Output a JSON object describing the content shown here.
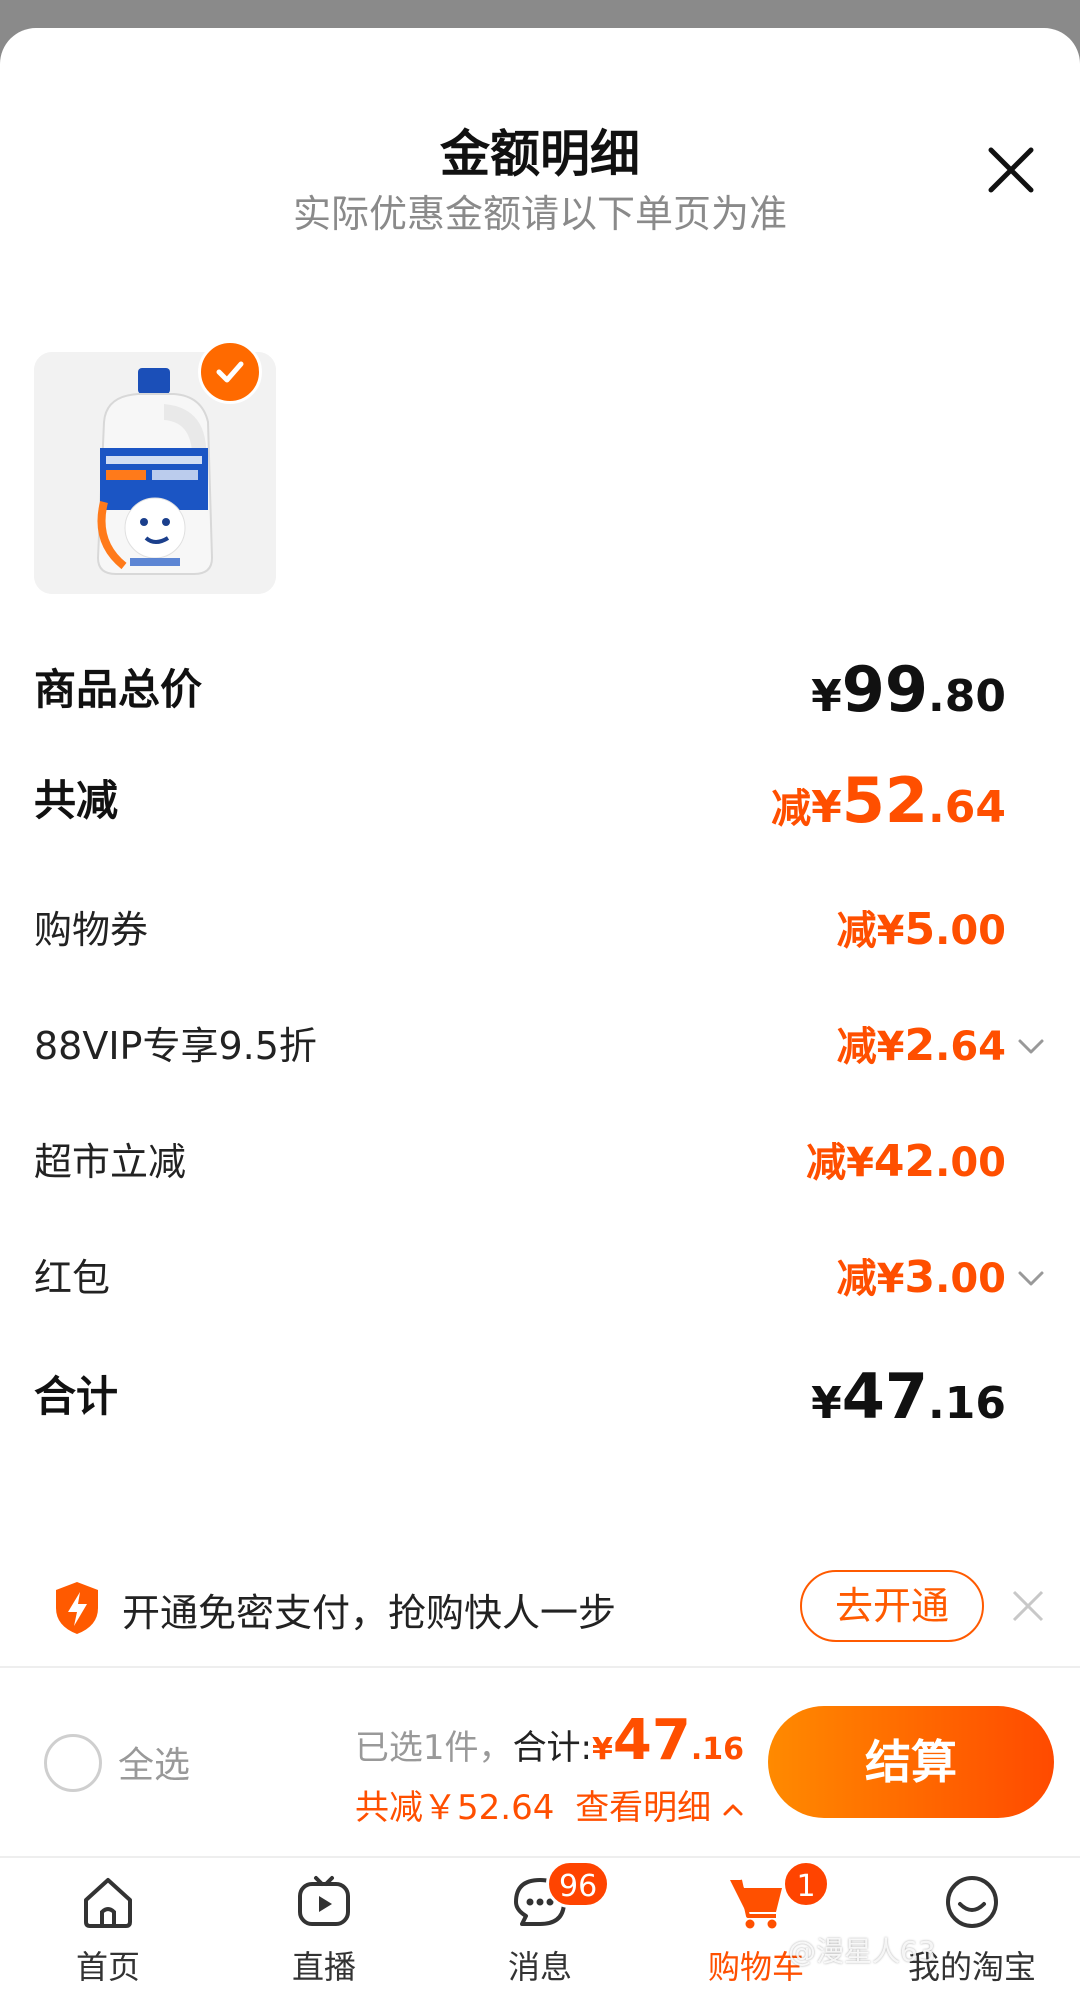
{
  "header": {
    "title": "金额明细",
    "subtitle": "实际优惠金额请以下单页为准"
  },
  "summary": {
    "total": {
      "label": "商品总价",
      "currency": "¥",
      "int": "99",
      "dec": ".80"
    },
    "reduced": {
      "label": "共减",
      "prefix": "减",
      "currency": "¥",
      "int": "52",
      "dec": ".64"
    },
    "items": [
      {
        "label": "购物券",
        "prefix": "减",
        "currency": "¥",
        "int": "5",
        "dec": ".00",
        "expandable": false
      },
      {
        "label": "88VIP专享9.5折",
        "prefix": "减",
        "currency": "¥",
        "int": "2",
        "dec": ".64",
        "expandable": true
      },
      {
        "label": "超市立减",
        "prefix": "减",
        "currency": "¥",
        "int": "42",
        "dec": ".00",
        "expandable": false
      },
      {
        "label": "红包",
        "prefix": "减",
        "currency": "¥",
        "int": "3",
        "dec": ".00",
        "expandable": true
      }
    ],
    "grand": {
      "label": "合计",
      "currency": "¥",
      "int": "47",
      "dec": ".16"
    }
  },
  "promo": {
    "text": "开通免密支付，抢购快人一步",
    "button": "去开通"
  },
  "checkout": {
    "select_all": "全选",
    "selected_text": "已选1件，",
    "total_label": "合计:",
    "currency": "¥",
    "int": "47",
    "dec": ".16",
    "reduced_text": "共减￥52.64",
    "details_link": "查看明细",
    "pay_button": "结算"
  },
  "tabbar": {
    "items": [
      {
        "label": "首页",
        "icon": "home-icon"
      },
      {
        "label": "直播",
        "icon": "live-icon"
      },
      {
        "label": "消息",
        "icon": "message-icon",
        "badge": "96"
      },
      {
        "label": "购物车",
        "icon": "cart-icon",
        "badge": "1",
        "active": true
      },
      {
        "label": "我的淘宝",
        "icon": "profile-icon"
      }
    ]
  },
  "watermark": "@漫星人63",
  "colors": {
    "accent": "#ff4f00",
    "button_gradient_start": "#ff8a00",
    "button_gradient_end": "#ff4a00"
  }
}
